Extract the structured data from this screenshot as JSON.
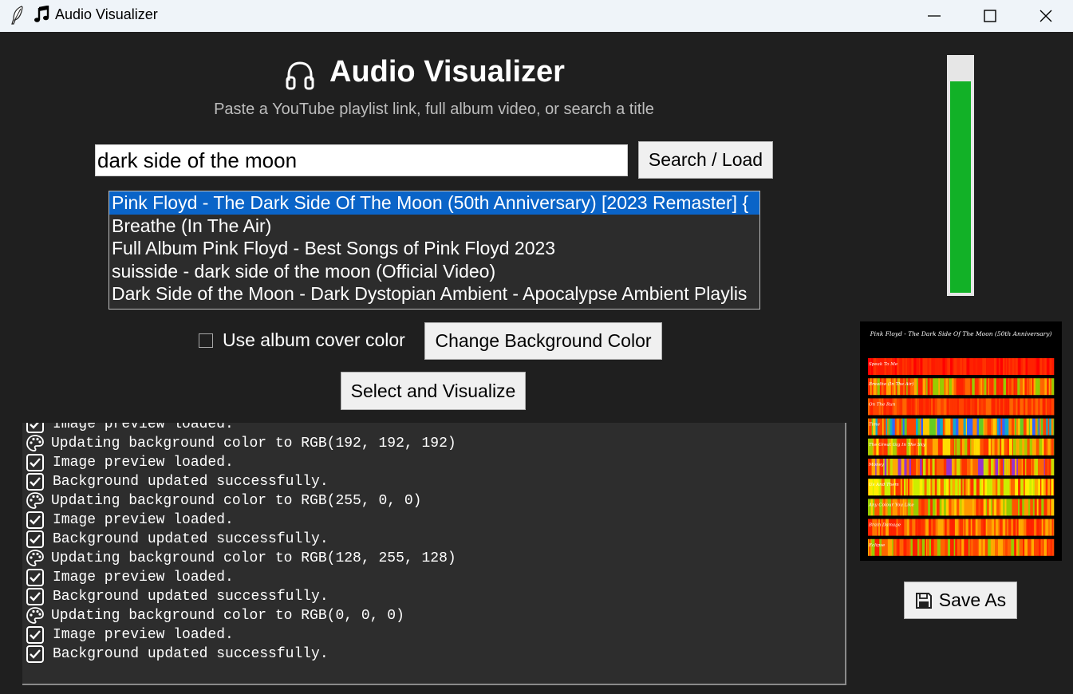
{
  "window": {
    "title": "Audio Visualizer",
    "app_icon": "feather-icon",
    "title_icon": "music-note-icon",
    "controls": [
      "minimize-icon",
      "maximize-icon",
      "close-icon"
    ]
  },
  "header": {
    "icon": "headphones-icon",
    "title": "Audio Visualizer",
    "subtitle": "Paste a YouTube playlist link, full album video, or search a title"
  },
  "search": {
    "value": "dark side of the moon",
    "button_label": "Search / Load"
  },
  "results": {
    "selected_index": 0,
    "items": [
      "Pink Floyd - The Dark Side Of The Moon (50th Anniversary) [2023 Remaster] {",
      "Breathe (In The Air)",
      "Full Album Pink Floyd - Best Songs of Pink Floyd 2023",
      "suisside - dark side of the moon (Official Video)",
      "Dark Side of the Moon - Dark Dystopian Ambient - Apocalypse Ambient Playlis"
    ]
  },
  "options": {
    "use_cover_color_label": "Use album cover color",
    "use_cover_color_checked": false,
    "change_bg_label": "Change Background Color",
    "visualize_label": "Select and Visualize"
  },
  "log": {
    "lines": [
      {
        "icon": "checkbox-icon",
        "text": "Image preview loaded."
      },
      {
        "icon": "palette-icon",
        "text": "Updating background color to RGB(192, 192, 192)"
      },
      {
        "icon": "checkbox-icon",
        "text": "Image preview loaded."
      },
      {
        "icon": "checkbox-icon",
        "text": "Background updated successfully."
      },
      {
        "icon": "palette-icon",
        "text": "Updating background color to RGB(255, 0, 0)"
      },
      {
        "icon": "checkbox-icon",
        "text": "Image preview loaded."
      },
      {
        "icon": "checkbox-icon",
        "text": "Background updated successfully."
      },
      {
        "icon": "palette-icon",
        "text": "Updating background color to RGB(128, 255, 128)"
      },
      {
        "icon": "checkbox-icon",
        "text": "Image preview loaded."
      },
      {
        "icon": "checkbox-icon",
        "text": "Background updated successfully."
      },
      {
        "icon": "palette-icon",
        "text": "Updating background color to RGB(0, 0, 0)"
      },
      {
        "icon": "checkbox-icon",
        "text": "Image preview loaded."
      },
      {
        "icon": "checkbox-icon",
        "text": "Background updated successfully."
      }
    ]
  },
  "meter": {
    "level": 0.89,
    "color": "#12b127"
  },
  "preview": {
    "title": "Pink Floyd - The Dark Side Of The Moon (50th Anniversary)",
    "tracks": [
      {
        "name": "Speak To Me",
        "palette": [
          "#ff1a00",
          "#ff3300",
          "#ff0000",
          "#ff2200"
        ]
      },
      {
        "name": "Breathe (In The Air)",
        "palette": [
          "#ff3300",
          "#ff6600",
          "#ffaa00",
          "#99cc00",
          "#ff2200"
        ]
      },
      {
        "name": "On The Run",
        "palette": [
          "#ff2200",
          "#ff4400",
          "#ff6600",
          "#ff3300"
        ]
      },
      {
        "name": "Time",
        "palette": [
          "#ff4400",
          "#ff8800",
          "#3366ff",
          "#11aacc",
          "#ffcc00",
          "#66cc22"
        ]
      },
      {
        "name": "The Great Gig In The Sky",
        "palette": [
          "#ff5500",
          "#ffaa00",
          "#ffdd00",
          "#aacc00",
          "#ff3300"
        ]
      },
      {
        "name": "Money",
        "palette": [
          "#ff3300",
          "#ffaa00",
          "#9933cc",
          "#ff6600",
          "#ccdd00"
        ]
      },
      {
        "name": "Us And Them",
        "palette": [
          "#ffee00",
          "#ccee00",
          "#ff6600",
          "#ff3300",
          "#ffaa00"
        ]
      },
      {
        "name": "Any Colour You Like",
        "palette": [
          "#ff5500",
          "#ff9900",
          "#99cc00",
          "#ffcc00",
          "#ff3300"
        ]
      },
      {
        "name": "Brain Damage",
        "palette": [
          "#ff3300",
          "#ff7700",
          "#ffaa00",
          "#ff2200"
        ]
      },
      {
        "name": "Eclipse",
        "palette": [
          "#ff2200",
          "#ff6600",
          "#ffaa00",
          "#99cc00",
          "#ff4400"
        ]
      }
    ]
  },
  "save": {
    "label": "Save As",
    "icon": "floppy-disk-icon"
  }
}
